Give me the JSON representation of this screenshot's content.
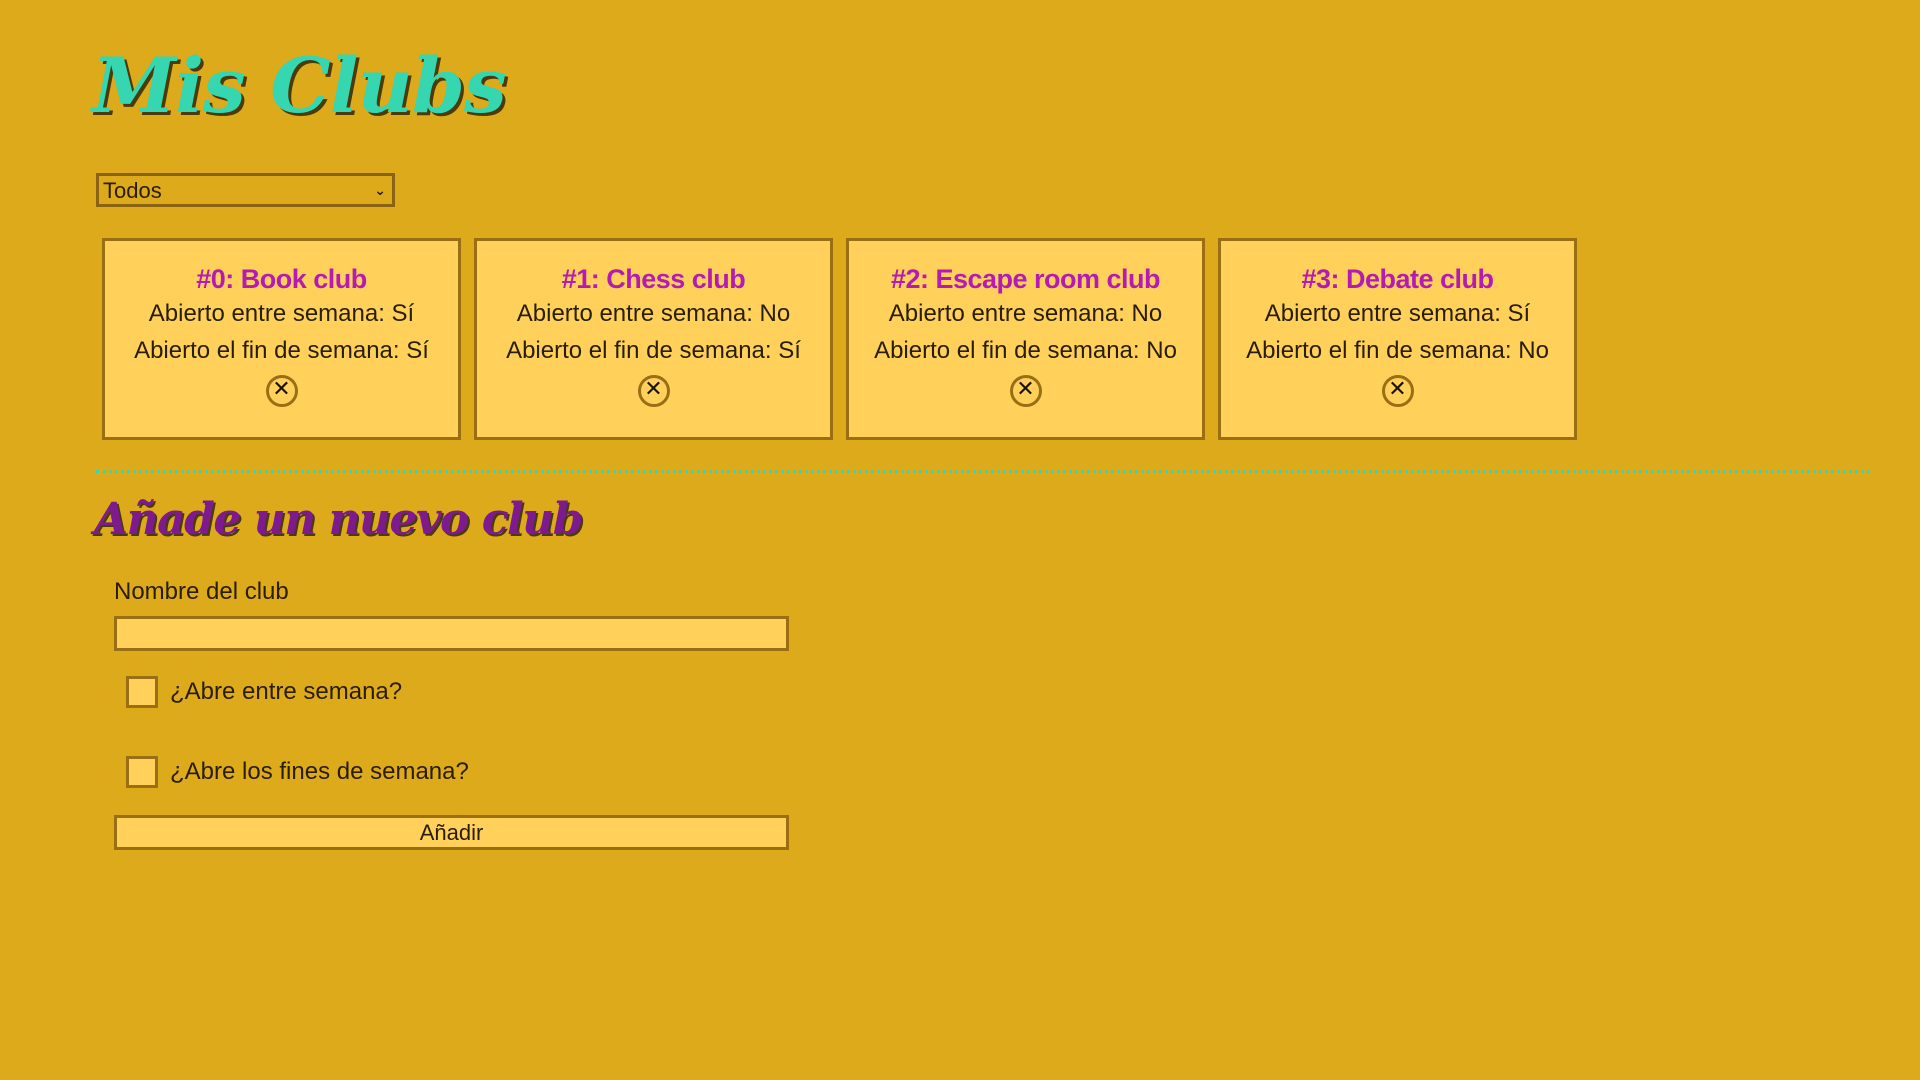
{
  "app": {
    "title": "Mis Clubs"
  },
  "filter": {
    "selected": "Todos",
    "chevron": "⌄"
  },
  "clubs": [
    {
      "title": "#0: Book club",
      "weekdays": "Abierto entre semana: Sí",
      "weekends": "Abierto el fin de semana: Sí",
      "delete_icon": "close-circle-icon"
    },
    {
      "title": "#1: Chess club",
      "weekdays": "Abierto entre semana: No",
      "weekends": "Abierto el fin de semana: Sí",
      "delete_icon": "close-circle-icon"
    },
    {
      "title": "#2: Escape room club",
      "weekdays": "Abierto entre semana: No",
      "weekends": "Abierto el fin de semana: No",
      "delete_icon": "close-circle-icon"
    },
    {
      "title": "#3: Debate club",
      "weekdays": "Abierto entre semana: Sí",
      "weekends": "Abierto el fin de semana: No",
      "delete_icon": "close-circle-icon"
    }
  ],
  "form": {
    "heading": "Añade un nuevo club",
    "name_label": "Nombre del club",
    "name_value": "",
    "weekdays_label": "¿Abre entre semana?",
    "weekdays_checked": false,
    "weekends_label": "¿Abre los fines de semana?",
    "weekends_checked": false,
    "submit_label": "Añadir"
  },
  "colors": {
    "background": "#ddaa1c",
    "card": "#ffd15a",
    "border": "#9a6f14",
    "title_accent": "#35d6b0",
    "club_title": "#b41bb4",
    "section_title": "#7d1a8d"
  }
}
